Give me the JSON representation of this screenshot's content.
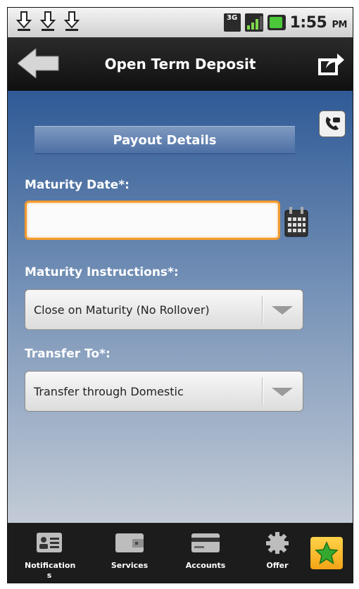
{
  "status_bar": {
    "network": "3G",
    "time": "1:55",
    "ampm": "PM"
  },
  "header": {
    "title": "Open Term Deposit"
  },
  "form": {
    "section_title": "Payout Details",
    "maturity_date_label": "Maturity Date*:",
    "maturity_date_value": "",
    "maturity_instructions_label": "Maturity Instructions*:",
    "maturity_instructions_value": "Close on Maturity (No Rollover)",
    "transfer_to_label": "Transfer To*:",
    "transfer_to_value": "Transfer through Domestic"
  },
  "bottom_nav": {
    "items": [
      {
        "label": "Notification s",
        "icon": "contact-card-icon"
      },
      {
        "label": "Services",
        "icon": "wallet-icon"
      },
      {
        "label": "Accounts",
        "icon": "credit-card-icon"
      },
      {
        "label": "Offer",
        "icon": "gear-icon"
      }
    ],
    "favorite_icon": "star-icon"
  },
  "colors": {
    "accent": "#f29a2e",
    "header_bg": "#101010",
    "content_top": "#2f5a96",
    "favorite": "#f3a416"
  }
}
